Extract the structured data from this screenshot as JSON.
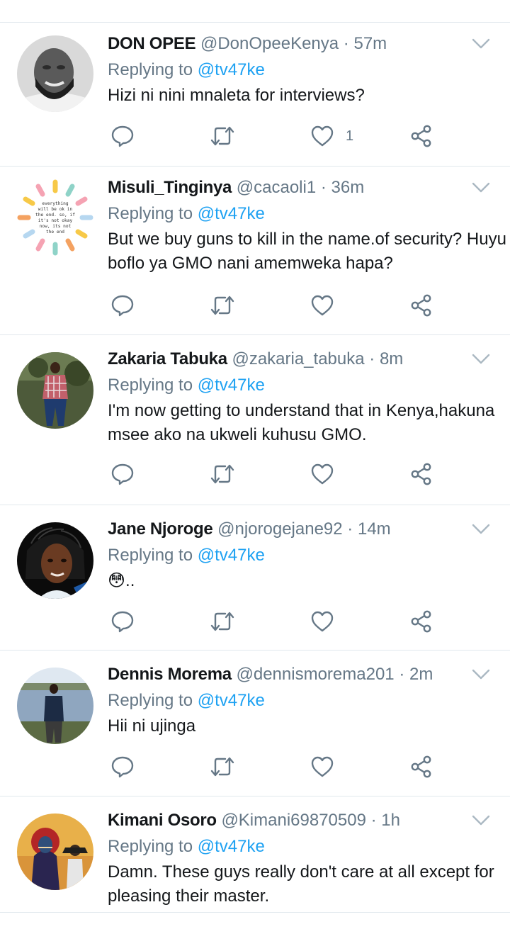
{
  "colors": {
    "accent": "#1da1f2",
    "secondary_text": "#657786",
    "divider": "#e1e8ed"
  },
  "reply_prefix": "Replying to",
  "tweets": [
    {
      "name": "DON OPEE",
      "handle": "@DonOpeeKenya",
      "separator": "·",
      "time": "57m",
      "reply_to": "@tv47ke",
      "text": "Hizi ni nini mnaleta for interviews?",
      "like_count": "1",
      "avatar_icon": "avatar-photo-grayscale-man"
    },
    {
      "name": "Misuli_Tinginya",
      "handle": "@cacaoli1",
      "separator": "·",
      "time": "36m",
      "reply_to": "@tv47ke",
      "text": "But we buy guns to kill in the name.of security? Huyu boflo ya GMO nani amemweka hapa?",
      "like_count": "",
      "avatar_icon": "avatar-quote-circle",
      "avatar_text": [
        "everything",
        "will be ok in",
        "the end. so, if",
        "it's not okay",
        "now, its not",
        "the end"
      ]
    },
    {
      "name": "Zakaria Tabuka",
      "handle": "@zakaria_tabuka",
      "separator": "·",
      "time": "8m",
      "reply_to": "@tv47ke",
      "text": "I'm now getting to understand that in Kenya,hakuna msee ako na ukweli kuhusu GMO.",
      "like_count": "",
      "avatar_icon": "avatar-photo-man-standing"
    },
    {
      "name": "Jane Njoroge",
      "handle": "@njorogejane92",
      "separator": "·",
      "time": "14m",
      "reply_to": "@tv47ke",
      "text": "😳..",
      "like_count": "",
      "avatar_icon": "avatar-photo-woman-braids"
    },
    {
      "name": "Dennis Morema",
      "handle": "@dennismorema201",
      "separator": "·",
      "time": "2m",
      "reply_to": "@tv47ke",
      "text": "Hii ni ujinga",
      "like_count": "",
      "avatar_icon": "avatar-photo-man-lakeside"
    },
    {
      "name": "Kimani Osoro",
      "handle": "@Kimani69870509",
      "separator": "·",
      "time": "1h",
      "reply_to": "@tv47ke",
      "text": "Damn. These guys really don't care at all except for pleasing their master.",
      "like_count": "",
      "avatar_icon": "avatar-illustration-hooded-figures"
    }
  ]
}
